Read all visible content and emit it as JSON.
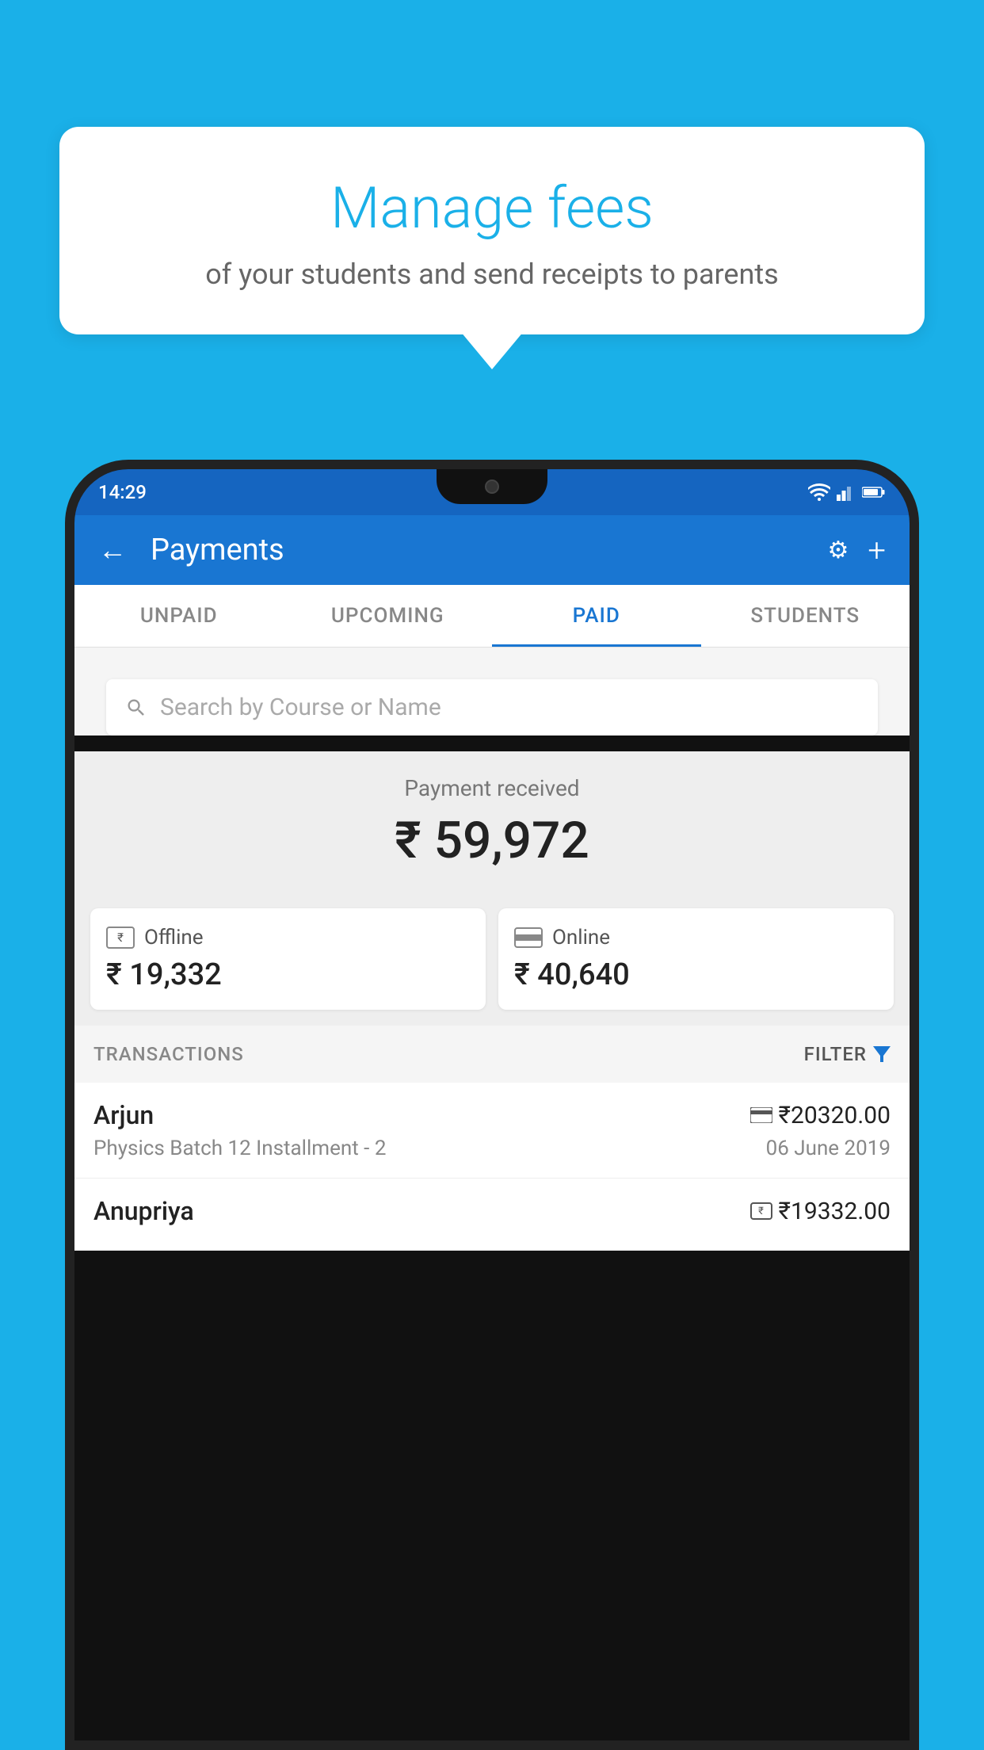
{
  "background_color": "#1ab0e8",
  "bubble": {
    "title": "Manage fees",
    "subtitle": "of your students and send receipts to parents"
  },
  "status_bar": {
    "time": "14:29"
  },
  "header": {
    "title": "Payments",
    "back_label": "←",
    "settings_label": "⚙",
    "add_label": "+"
  },
  "tabs": [
    {
      "label": "UNPAID",
      "active": false
    },
    {
      "label": "UPCOMING",
      "active": false
    },
    {
      "label": "PAID",
      "active": true
    },
    {
      "label": "STUDENTS",
      "active": false
    }
  ],
  "search": {
    "placeholder": "Search by Course or Name"
  },
  "payment_summary": {
    "label": "Payment received",
    "amount": "₹ 59,972"
  },
  "offline_card": {
    "icon": "₹",
    "label": "Offline",
    "amount": "₹ 19,332"
  },
  "online_card": {
    "label": "Online",
    "amount": "₹ 40,640"
  },
  "transactions_header": {
    "label": "TRANSACTIONS",
    "filter_label": "FILTER"
  },
  "transactions": [
    {
      "name": "Arjun",
      "course": "Physics Batch 12 Installment - 2",
      "amount": "₹20320.00",
      "date": "06 June 2019",
      "payment_type": "online"
    },
    {
      "name": "Anupriya",
      "course": "",
      "amount": "₹19332.00",
      "date": "",
      "payment_type": "offline"
    }
  ]
}
